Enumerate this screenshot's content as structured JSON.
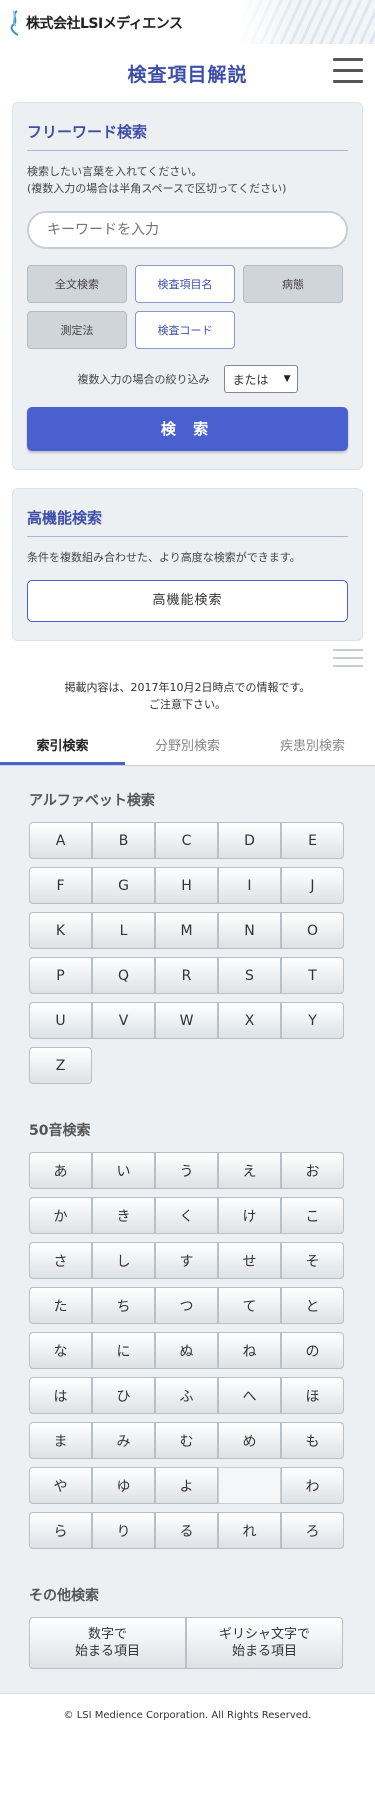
{
  "header": {
    "logo_text": "株式会社LSIメディエンス",
    "page_title": "検査項目解説"
  },
  "freeword": {
    "title": "フリーワード検索",
    "desc_line1": "検索したい言葉を入れてください。",
    "desc_line2": "(複数入力の場合は半角スペースで区切ってください)",
    "placeholder": "キーワードを入力",
    "categories": [
      {
        "label": "全文検索",
        "selected": false
      },
      {
        "label": "検査項目名",
        "selected": true
      },
      {
        "label": "病態",
        "selected": false
      },
      {
        "label": "測定法",
        "selected": false
      },
      {
        "label": "検査コード",
        "selected": true
      }
    ],
    "narrow_label": "複数入力の場合の絞り込み",
    "narrow_value": "または",
    "search_button": "検 索"
  },
  "advanced": {
    "title": "高機能検索",
    "desc": "条件を複数組み合わせた、より高度な検索ができます。",
    "button": "高機能検索"
  },
  "notice": {
    "line1": "掲載内容は、2017年10月2日時点での情報です。",
    "line2": "ご注意下さい。"
  },
  "tabs": [
    {
      "label": "索引検索",
      "active": true
    },
    {
      "label": "分野別検索",
      "active": false
    },
    {
      "label": "疾患別検索",
      "active": false
    }
  ],
  "alphabet": {
    "title": "アルファベット検索",
    "keys": [
      "A",
      "B",
      "C",
      "D",
      "E",
      "F",
      "G",
      "H",
      "I",
      "J",
      "K",
      "L",
      "M",
      "N",
      "O",
      "P",
      "Q",
      "R",
      "S",
      "T",
      "U",
      "V",
      "W",
      "X",
      "Y",
      "Z"
    ]
  },
  "kana": {
    "title": "50音検索",
    "keys": [
      "あ",
      "い",
      "う",
      "え",
      "お",
      "か",
      "き",
      "く",
      "け",
      "こ",
      "さ",
      "し",
      "す",
      "せ",
      "そ",
      "た",
      "ち",
      "つ",
      "て",
      "と",
      "な",
      "に",
      "ぬ",
      "ね",
      "の",
      "は",
      "ひ",
      "ふ",
      "へ",
      "ほ",
      "ま",
      "み",
      "む",
      "め",
      "も",
      "や",
      "ゆ",
      "よ",
      "",
      "わ",
      "ら",
      "り",
      "る",
      "れ",
      "ろ"
    ]
  },
  "other": {
    "title": "その他検索",
    "digit_line1": "数字で",
    "digit_line2": "始まる項目",
    "greek_line1": "ギリシャ文字で",
    "greek_line2": "始まる項目"
  },
  "footer": {
    "copyright": "© LSI Medience Corporation. All Rights Reserved."
  },
  "colors": {
    "accent": "#4a60cf",
    "title": "#3f4fa8",
    "panel_bg": "#edf0f2"
  }
}
